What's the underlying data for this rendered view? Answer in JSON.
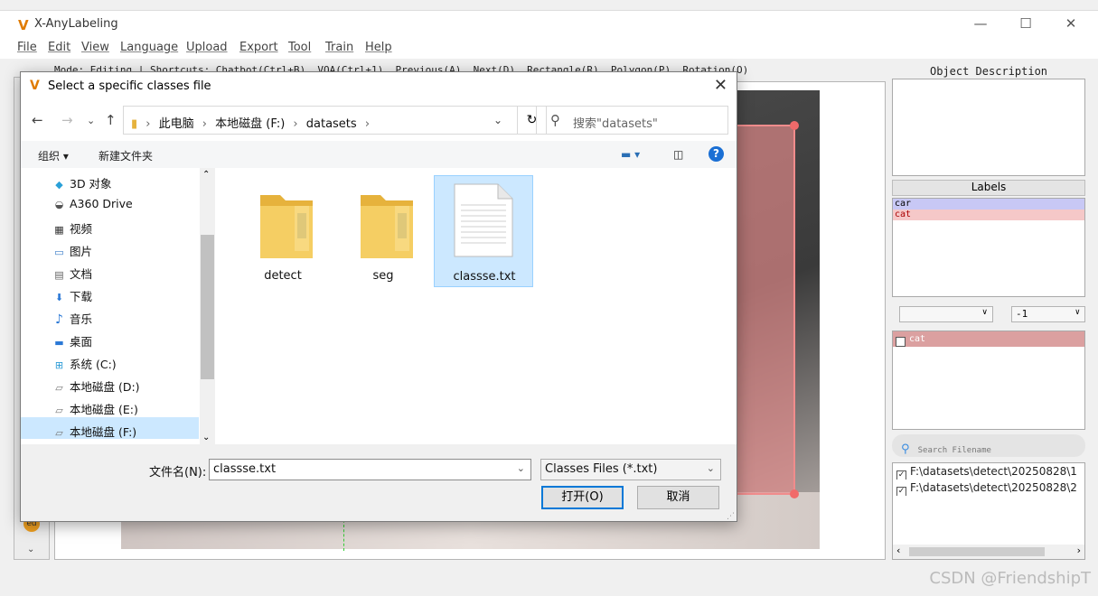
{
  "app": {
    "logo": "V",
    "title": "X-AnyLabeling",
    "window_controls": [
      "—",
      "☐",
      "✕"
    ]
  },
  "menu": [
    "File",
    "Edit",
    "View",
    "Language",
    "Upload",
    "Export",
    "Tool",
    "Train",
    "Help"
  ],
  "modebar": {
    "text": "Mode: Editing | Shortcuts: Chatbot(Ctrl+B), VQA(Ctrl+1), Previous(A), Next(D), Rectangle(R), Polygon(P), Rotation(O)"
  },
  "right_panel": {
    "object_description_title": "Object Description",
    "labels_title": "Labels",
    "labels": [
      {
        "name": "car",
        "color": "#c8c8f5"
      },
      {
        "name": "cat",
        "color": "#f5c8c8"
      }
    ],
    "combo_left": "",
    "combo_right": "-1",
    "shapes": [
      {
        "name": "cat",
        "checked": true
      }
    ],
    "search_placeholder": "Search Filename",
    "file_list": [
      {
        "path": "F:\\datasets\\detect\\20250828\\1",
        "checked": true
      },
      {
        "path": "F:\\datasets\\detect\\20250828\\2",
        "checked": true
      }
    ]
  },
  "dialog": {
    "title": "Select a specific classes file",
    "address": [
      "此电脑",
      "本地磁盘 (F:)",
      "datasets"
    ],
    "search_placeholder": "搜索\"datasets\"",
    "toolbar": {
      "organize": "组织 ▾",
      "new_folder": "新建文件夹"
    },
    "nav_items": [
      {
        "icon": "cube-icon",
        "label": "3D 对象"
      },
      {
        "icon": "drive-icon",
        "label": "A360 Drive"
      },
      {
        "icon": "video-icon",
        "label": "视频"
      },
      {
        "icon": "picture-icon",
        "label": "图片"
      },
      {
        "icon": "document-icon",
        "label": "文档"
      },
      {
        "icon": "download-icon",
        "label": "下载"
      },
      {
        "icon": "music-icon",
        "label": "音乐"
      },
      {
        "icon": "desktop-icon",
        "label": "桌面"
      },
      {
        "icon": "windows-drive-icon",
        "label": "系统 (C:)"
      },
      {
        "icon": "disk-icon",
        "label": "本地磁盘 (D:)"
      },
      {
        "icon": "disk-icon",
        "label": "本地磁盘 (E:)"
      },
      {
        "icon": "disk-icon",
        "label": "本地磁盘 (F:)"
      }
    ],
    "files": [
      {
        "name": "detect",
        "type": "folder"
      },
      {
        "name": "seg",
        "type": "folder"
      },
      {
        "name": "classse.txt",
        "type": "text"
      }
    ],
    "filename_label": "文件名(N):",
    "filename_value": "classse.txt",
    "filetype": "Classes Files (*.txt)",
    "open_label": "打开(O)",
    "cancel_label": "取消"
  },
  "watermark": "CSDN @FriendshipT"
}
